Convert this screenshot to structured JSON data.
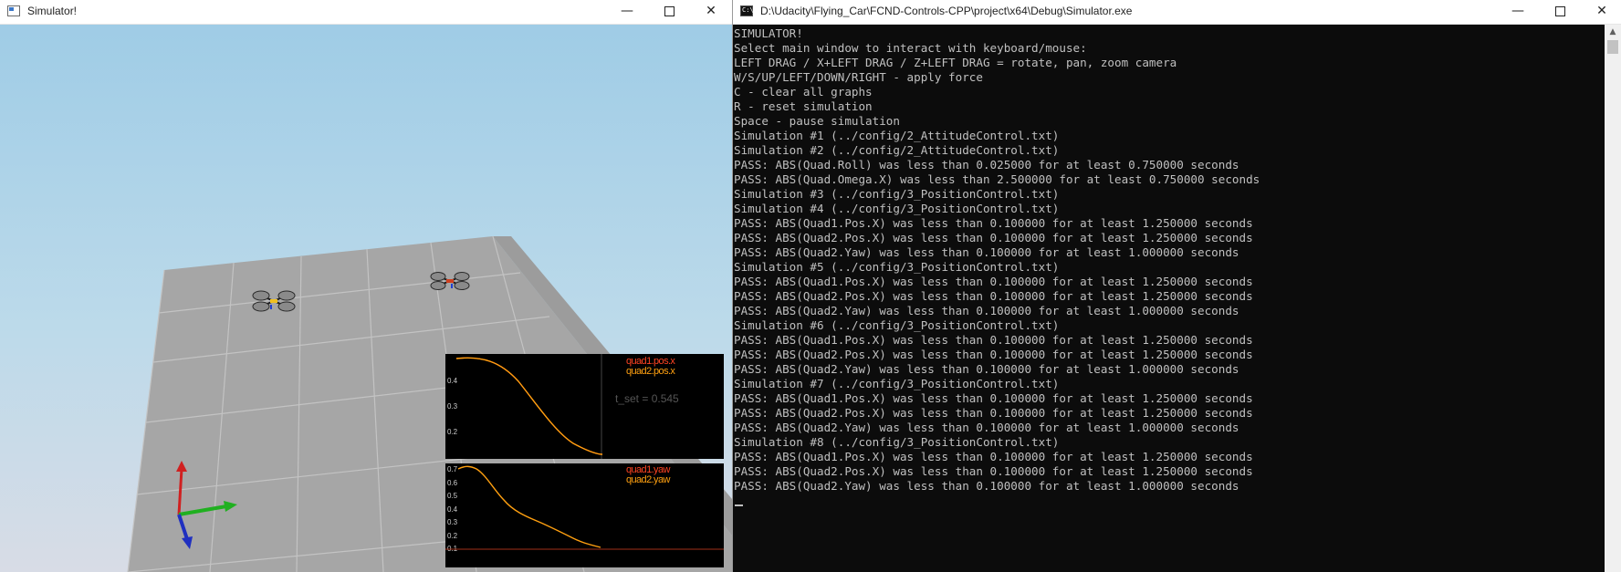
{
  "simulator_window": {
    "title": "Simulator!",
    "controls": {
      "minimize": "—",
      "close": "✕"
    },
    "plot_top": {
      "legend": [
        {
          "label": "quad1.pos.x",
          "color": "#ff4422"
        },
        {
          "label": "quad2.pos.x",
          "color": "#ffa010"
        }
      ],
      "y_ticks": [
        "0.4",
        "0.3",
        "0.2"
      ],
      "annotation": "t_set = 0.545"
    },
    "plot_bottom": {
      "legend": [
        {
          "label": "quad1.yaw",
          "color": "#ff4422"
        },
        {
          "label": "quad2.yaw",
          "color": "#ffa010"
        }
      ],
      "y_ticks": [
        "0.7",
        "0.6",
        "0.5",
        "0.4",
        "0.3",
        "0.2",
        "0.1"
      ]
    },
    "axes_colors": {
      "z": "#d02020",
      "x": "#20b020",
      "y": "#2030c0"
    }
  },
  "console_window": {
    "title": "D:\\Udacity\\Flying_Car\\FCND-Controls-CPP\\project\\x64\\Debug\\Simulator.exe",
    "controls": {
      "minimize": "—",
      "close": "✕"
    },
    "lines": [
      "SIMULATOR!",
      "Select main window to interact with keyboard/mouse:",
      "LEFT DRAG / X+LEFT DRAG / Z+LEFT DRAG = rotate, pan, zoom camera",
      "W/S/UP/LEFT/DOWN/RIGHT - apply force",
      "C - clear all graphs",
      "R - reset simulation",
      "Space - pause simulation",
      "Simulation #1 (../config/2_AttitudeControl.txt)",
      "Simulation #2 (../config/2_AttitudeControl.txt)",
      "PASS: ABS(Quad.Roll) was less than 0.025000 for at least 0.750000 seconds",
      "PASS: ABS(Quad.Omega.X) was less than 2.500000 for at least 0.750000 seconds",
      "Simulation #3 (../config/3_PositionControl.txt)",
      "Simulation #4 (../config/3_PositionControl.txt)",
      "PASS: ABS(Quad1.Pos.X) was less than 0.100000 for at least 1.250000 seconds",
      "PASS: ABS(Quad2.Pos.X) was less than 0.100000 for at least 1.250000 seconds",
      "PASS: ABS(Quad2.Yaw) was less than 0.100000 for at least 1.000000 seconds",
      "Simulation #5 (../config/3_PositionControl.txt)",
      "PASS: ABS(Quad1.Pos.X) was less than 0.100000 for at least 1.250000 seconds",
      "PASS: ABS(Quad2.Pos.X) was less than 0.100000 for at least 1.250000 seconds",
      "PASS: ABS(Quad2.Yaw) was less than 0.100000 for at least 1.000000 seconds",
      "Simulation #6 (../config/3_PositionControl.txt)",
      "PASS: ABS(Quad1.Pos.X) was less than 0.100000 for at least 1.250000 seconds",
      "PASS: ABS(Quad2.Pos.X) was less than 0.100000 for at least 1.250000 seconds",
      "PASS: ABS(Quad2.Yaw) was less than 0.100000 for at least 1.000000 seconds",
      "Simulation #7 (../config/3_PositionControl.txt)",
      "PASS: ABS(Quad1.Pos.X) was less than 0.100000 for at least 1.250000 seconds",
      "PASS: ABS(Quad2.Pos.X) was less than 0.100000 for at least 1.250000 seconds",
      "PASS: ABS(Quad2.Yaw) was less than 0.100000 for at least 1.000000 seconds",
      "Simulation #8 (../config/3_PositionControl.txt)",
      "PASS: ABS(Quad1.Pos.X) was less than 0.100000 for at least 1.250000 seconds",
      "PASS: ABS(Quad2.Pos.X) was less than 0.100000 for at least 1.250000 seconds",
      "PASS: ABS(Quad2.Yaw) was less than 0.100000 for at least 1.000000 seconds"
    ]
  }
}
